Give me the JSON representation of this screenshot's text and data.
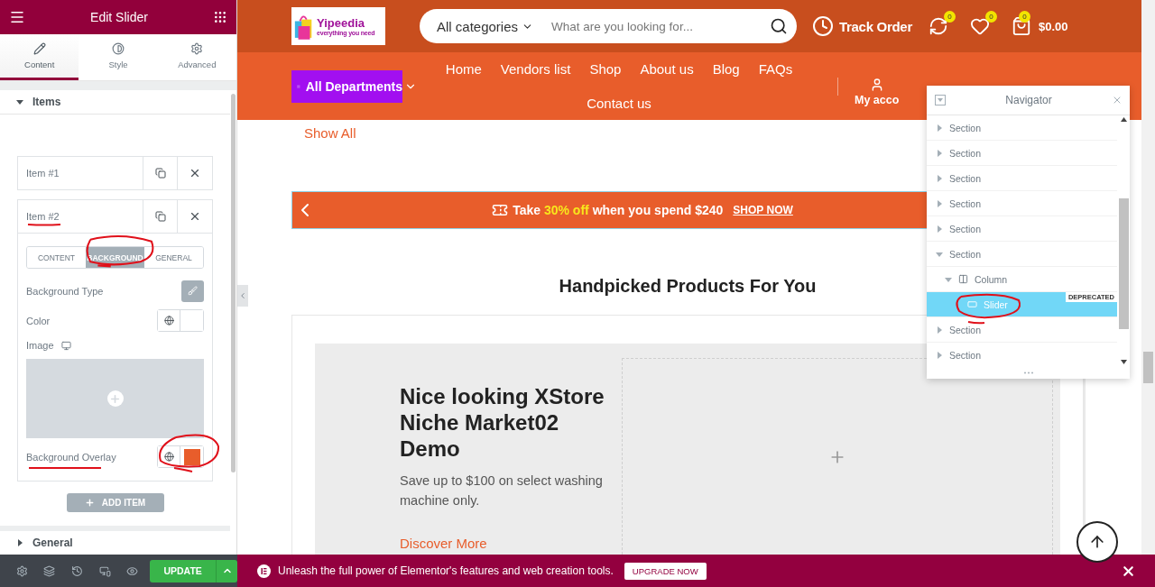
{
  "panel": {
    "title": "Edit Slider",
    "tabs": [
      {
        "label": "Content",
        "kind": "content",
        "selected": true
      },
      {
        "label": "Style",
        "kind": "style",
        "selected": false
      },
      {
        "label": "Advanced",
        "kind": "advanced",
        "selected": false
      }
    ],
    "sections": [
      {
        "title": "Items",
        "expanded": true
      },
      {
        "title": "General",
        "expanded": false
      }
    ],
    "items": [
      {
        "label": "Item #1",
        "expanded": false
      },
      {
        "label": "Item #2",
        "expanded": true,
        "tabs": [
          {
            "label": "CONTENT",
            "selected": false
          },
          {
            "label": "BACKGROUND",
            "selected": true
          },
          {
            "label": "GENERAL",
            "selected": false
          }
        ],
        "fields": [
          {
            "label": "Background Type",
            "kind": "toggle"
          },
          {
            "label": "Color",
            "kind": "color"
          },
          {
            "label": "Image",
            "kind": "image"
          },
          {
            "label": "Background Overlay",
            "kind": "color",
            "color": "#e85d2b"
          }
        ]
      }
    ],
    "add_button": "ADD ITEM",
    "update_button": "UPDATE"
  },
  "site": {
    "logo": {
      "name": "Yipeedia",
      "tagline": "everything you need"
    },
    "search": {
      "category": "All categories",
      "placeholder": "What are you looking for..."
    },
    "track_order": "Track Order",
    "compare_count": "0",
    "wishlist_count": "0",
    "cart_count": "0",
    "cart_total": "$0.00",
    "departments": "All Departments",
    "menu": [
      "Home",
      "Vendors list",
      "Shop",
      "About us",
      "Blog",
      "FAQs",
      "Contact us"
    ],
    "account": "My acco",
    "show_all": "Show All",
    "promo": {
      "before": "Take",
      "highlight": "30% off",
      "after": "when you spend $240",
      "link": "SHOP NOW"
    },
    "heading": "Handpicked Products For You",
    "slide": {
      "title": "Nice looking XStore Niche Market02 Demo",
      "text": "Save up to $100 on select washing machine only.",
      "link": "Discover More"
    }
  },
  "navigator": {
    "title": "Navigator",
    "tree": [
      {
        "label": "Section",
        "kind": "section",
        "expanded": false,
        "selected": false
      },
      {
        "label": "Section",
        "kind": "section",
        "expanded": false,
        "selected": false
      },
      {
        "label": "Section",
        "kind": "section",
        "expanded": false,
        "selected": false
      },
      {
        "label": "Section",
        "kind": "section",
        "expanded": false,
        "selected": false
      },
      {
        "label": "Section",
        "kind": "section",
        "expanded": false,
        "selected": false
      },
      {
        "label": "Section",
        "kind": "section",
        "expanded": true,
        "selected": false,
        "children": [
          {
            "label": "Column",
            "kind": "column",
            "expanded": true,
            "selected": false,
            "children": [
              {
                "label": "Slider",
                "kind": "widget",
                "selected": true,
                "badge": "DEPRECATED"
              }
            ]
          }
        ]
      },
      {
        "label": "Section",
        "kind": "section",
        "expanded": false,
        "selected": false
      },
      {
        "label": "Section",
        "kind": "section",
        "expanded": false,
        "selected": false
      }
    ]
  },
  "banner": {
    "text": "Unleash the full power of Elementor's features and web creation tools.",
    "button": "UPGRADE NOW"
  }
}
